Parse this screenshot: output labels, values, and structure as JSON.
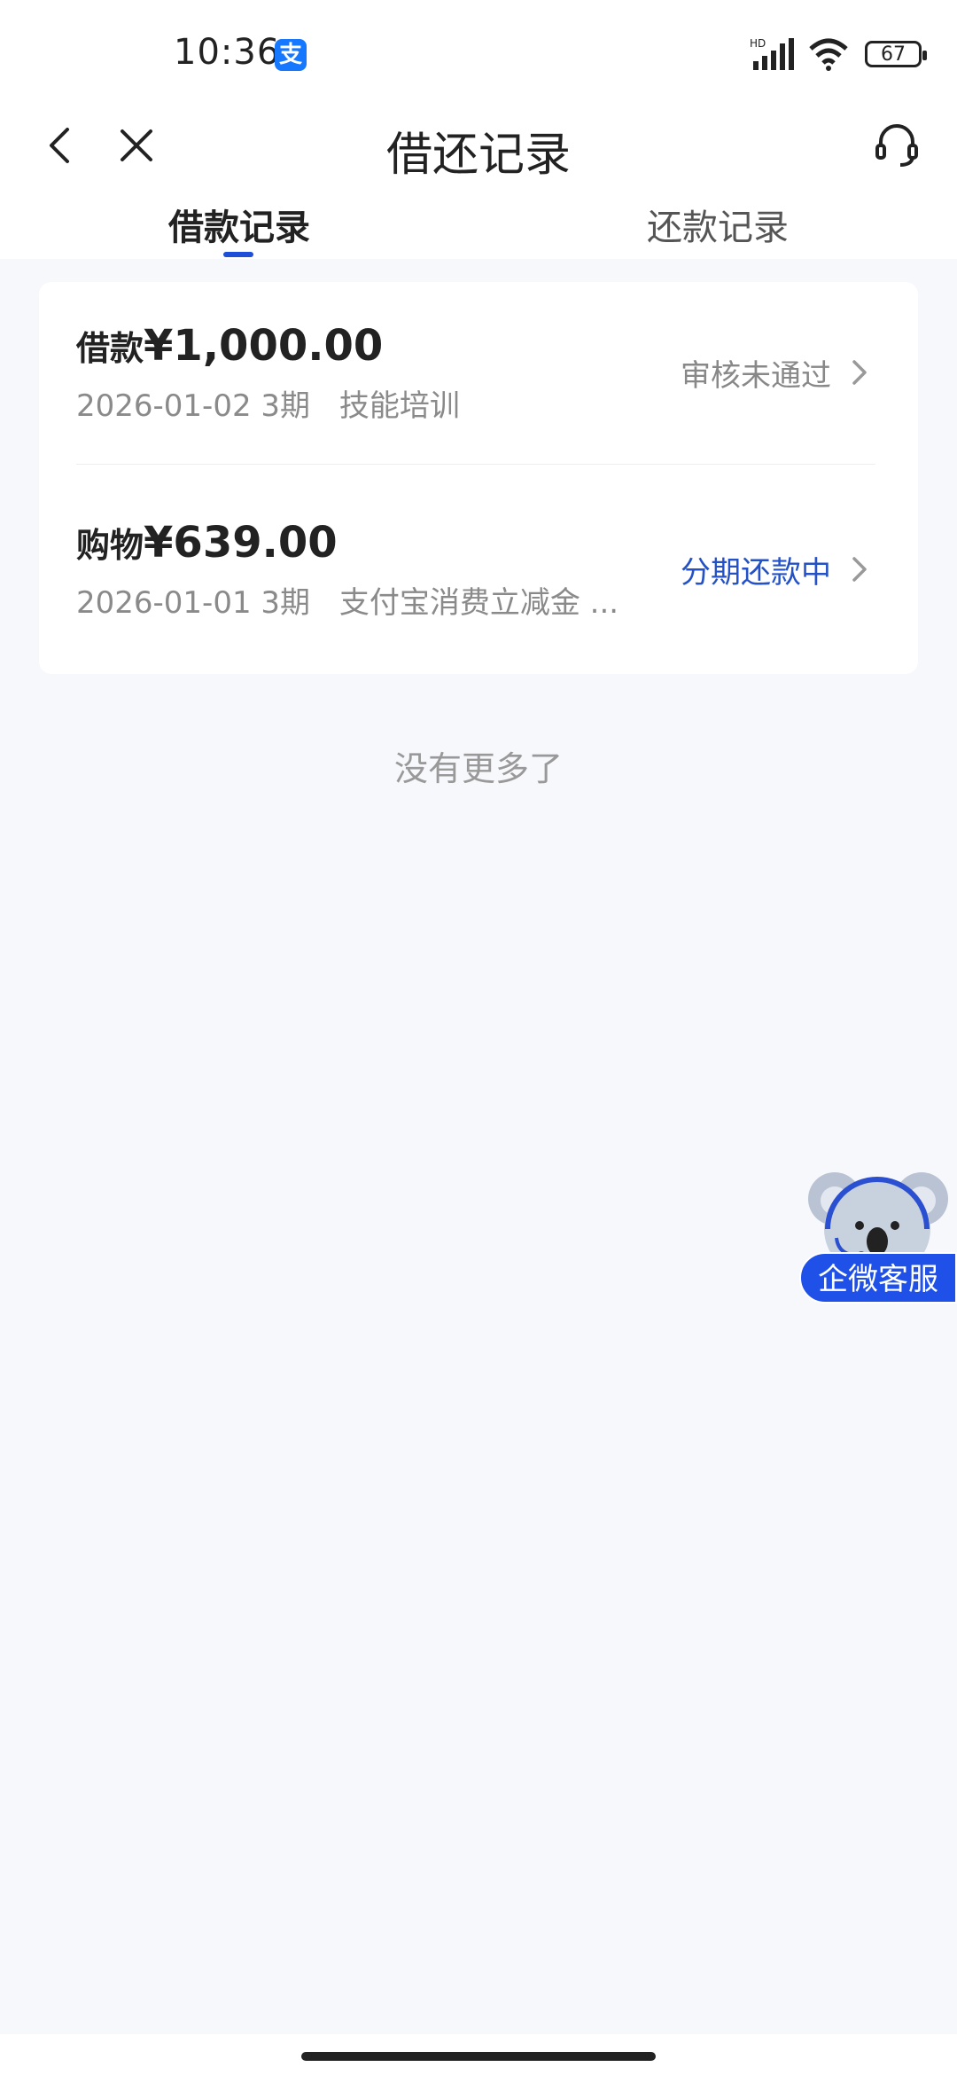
{
  "status_bar": {
    "time": "10:36",
    "app_badge": "支",
    "signal_label": "HD",
    "battery": "67"
  },
  "nav": {
    "title": "借还记录",
    "back_icon": "back-arrow-icon",
    "close_icon": "close-icon",
    "support_icon": "headset-icon"
  },
  "tabs": [
    {
      "label": "借款记录",
      "active": true
    },
    {
      "label": "还款记录",
      "active": false
    }
  ],
  "records": [
    {
      "type_label": "借款",
      "amount": "¥1,000.00",
      "date": "2026-01-02",
      "term": "3期",
      "purpose": "技能培训",
      "status": "审核未通过",
      "status_color": "#888888"
    },
    {
      "type_label": "购物",
      "amount": "¥639.00",
      "date": "2026-01-01",
      "term": "3期",
      "purpose": "支付宝消费立减金 ...",
      "status": "分期还款中",
      "status_color": "#2452c6"
    }
  ],
  "footer_text": "没有更多了",
  "floating_service": {
    "label": "企微客服",
    "icon": "koala-mascot-icon"
  },
  "colors": {
    "accent": "#1f4fd8",
    "background": "#f7f8fc"
  }
}
